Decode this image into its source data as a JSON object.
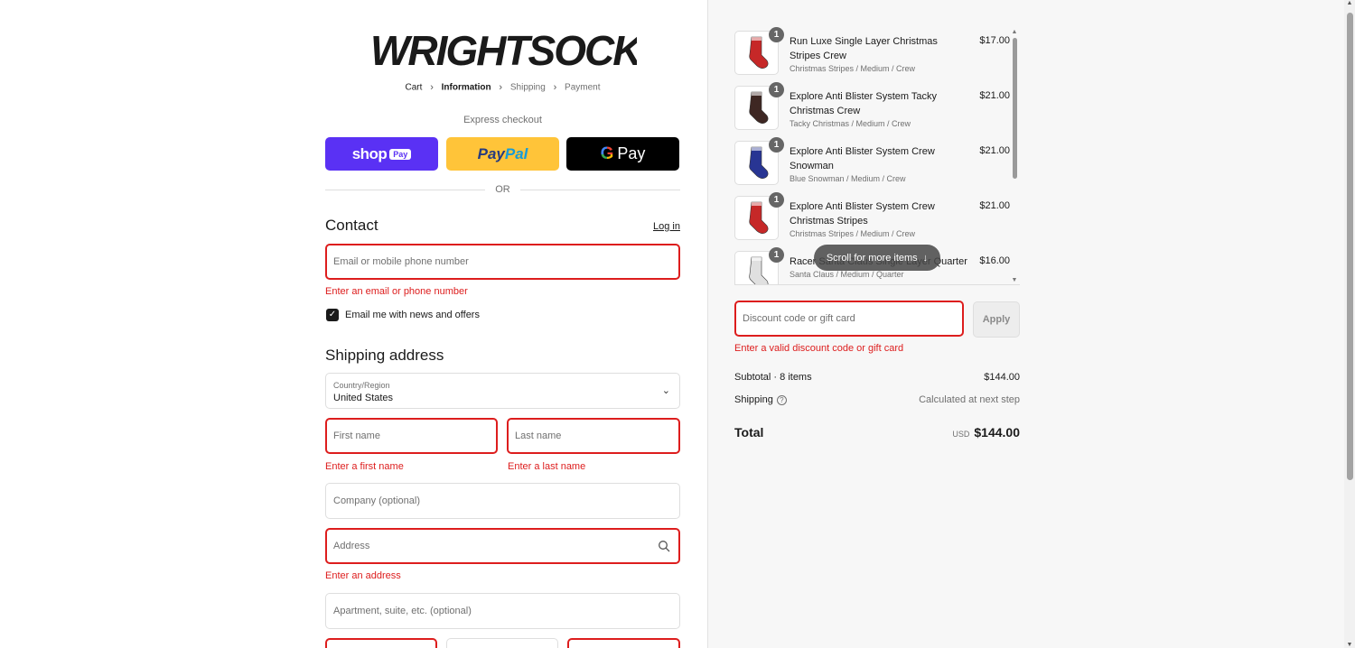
{
  "brand": {
    "name": "WRIGHTSOCK"
  },
  "breadcrumb": {
    "cart": "Cart",
    "information": "Information",
    "shipping": "Shipping",
    "payment": "Payment"
  },
  "express": {
    "label": "Express checkout",
    "shop_text": "shop",
    "shop_badge": "Pay",
    "paypal_pay": "Pay",
    "paypal_pal": "Pal",
    "gpay_g": "G",
    "gpay_text": "Pay",
    "or": "OR"
  },
  "contact": {
    "title": "Contact",
    "login": "Log in",
    "email_placeholder": "Email or mobile phone number",
    "email_error": "Enter an email or phone number",
    "newsletter_label": "Email me with news and offers",
    "newsletter_checked": true
  },
  "shipping_address": {
    "title": "Shipping address",
    "country_label": "Country/Region",
    "country_value": "United States",
    "first_name_placeholder": "First name",
    "first_name_error": "Enter a first name",
    "last_name_placeholder": "Last name",
    "last_name_error": "Enter a last name",
    "company_placeholder": "Company (optional)",
    "address_placeholder": "Address",
    "address_error": "Enter an address",
    "apartment_placeholder": "Apartment, suite, etc. (optional)"
  },
  "order": {
    "items": [
      {
        "qty": "1",
        "name": "Run Luxe Single Layer Christmas Stripes Crew",
        "variant": "Christmas Stripes / Medium / Crew",
        "price": "$17.00",
        "color": "#c62828"
      },
      {
        "qty": "1",
        "name": "Explore Anti Blister System Tacky Christmas Crew",
        "variant": "Tacky Christmas / Medium / Crew",
        "price": "$21.00",
        "color": "#3e2723"
      },
      {
        "qty": "1",
        "name": "Explore Anti Blister System Crew Snowman",
        "variant": "Blue Snowman / Medium / Crew",
        "price": "$21.00",
        "color": "#283593"
      },
      {
        "qty": "1",
        "name": "Explore Anti Blister System Crew Christmas Stripes",
        "variant": "Christmas Stripes / Medium / Crew",
        "price": "$21.00",
        "color": "#c62828"
      },
      {
        "qty": "1",
        "name": "Racer Santa Claus Single Layer Quarter",
        "variant": "Santa Claus / Medium / Quarter",
        "price": "$16.00",
        "color": "#e0e0e0"
      }
    ],
    "scroll_hint": "Scroll for more items",
    "discount_placeholder": "Discount code or gift card",
    "discount_error": "Enter a valid discount code or gift card",
    "apply": "Apply",
    "subtotal_label": "Subtotal · 8 items",
    "subtotal_value": "$144.00",
    "shipping_label": "Shipping",
    "shipping_value": "Calculated at next step",
    "total_label": "Total",
    "currency": "USD",
    "total_value": "$144.00"
  },
  "colors": {
    "error": "#dd1d1d",
    "shop_pay": "#5a31f4",
    "paypal": "#ffc439",
    "gpay": "#000000"
  }
}
